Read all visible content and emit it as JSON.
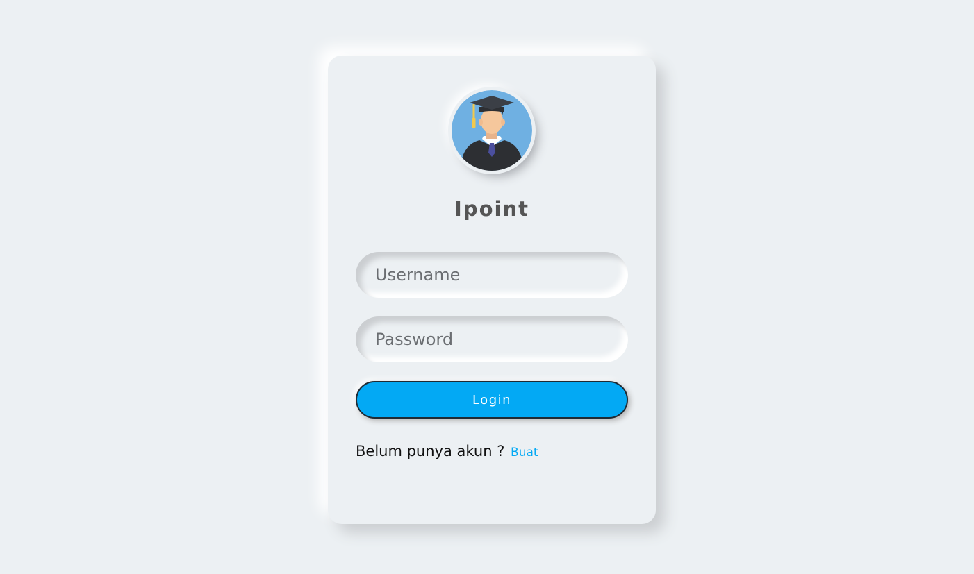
{
  "app": {
    "title": "Ipoint"
  },
  "avatar": {
    "icon": "graduate-avatar-icon"
  },
  "form": {
    "username_placeholder": "Username",
    "username_value": "",
    "password_placeholder": "Password",
    "password_value": "",
    "login_label": "Login"
  },
  "signup": {
    "prompt": "Belum punya akun ?",
    "link_label": "Buat"
  },
  "colors": {
    "background": "#ecf0f3",
    "accent": "#03a9f4",
    "title_text": "#555555",
    "avatar_bg": "#6fb0e2"
  }
}
